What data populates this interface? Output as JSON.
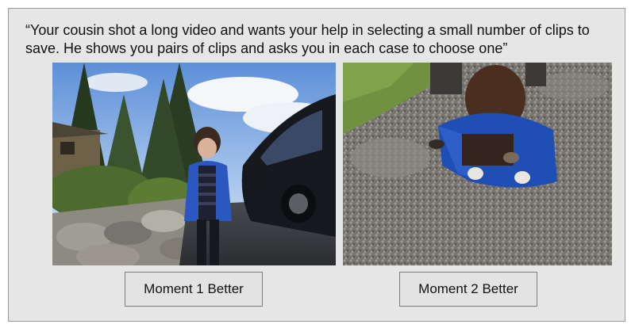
{
  "prompt": {
    "text": "“Your cousin shot a long video and wants your help in selecting a small number of clips to save. He shows you pairs of clips and asks you in each case to choose one”"
  },
  "clips": [
    {
      "icon": "video-frame-child-standing-by-car"
    },
    {
      "icon": "video-frame-child-crouching-on-gravel"
    }
  ],
  "buttons": {
    "moment1": "Moment 1 Better",
    "moment2": "Moment 2 Better"
  },
  "colors": {
    "panel_background": "#e6e6e6",
    "panel_border": "#9a9a9a",
    "button_background": "#e3e3e3",
    "button_border": "#7d7d7d"
  }
}
